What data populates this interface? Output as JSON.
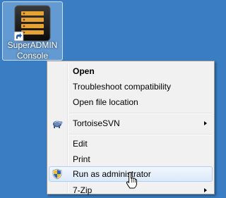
{
  "desktop": {
    "icon_label_line1": "SuperADMIN",
    "icon_label_line2": "Console",
    "icon_name": "superadmin-app-icon",
    "background_color": "#3a7dc2"
  },
  "context_menu": {
    "items": [
      {
        "label": "Open",
        "bold": true
      },
      {
        "label": "Troubleshoot compatibility"
      },
      {
        "label": "Open file location"
      },
      {
        "label": "TortoiseSVN",
        "icon": "tortoisesvn-icon",
        "submenu": true
      },
      {
        "label": "Edit"
      },
      {
        "label": "Print"
      },
      {
        "label": "Run as administrator",
        "icon": "uac-shield-icon",
        "highlighted": true
      },
      {
        "label": "7-Zip",
        "submenu": true
      }
    ]
  },
  "cursor": {
    "type": "hand-pointer-icon"
  }
}
